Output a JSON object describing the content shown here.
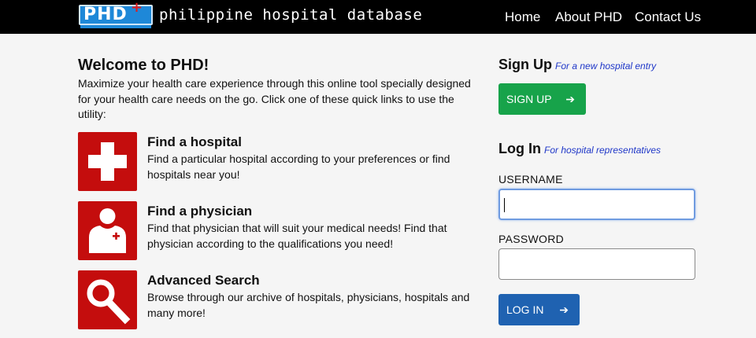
{
  "header": {
    "logo_text": "PHD",
    "tagline": "philippine hospital database",
    "nav": [
      "Home",
      "About PHD",
      "Contact Us"
    ],
    "colors": {
      "bar": "#000000",
      "logo_blue": "#1e88d8",
      "logo_plus": "#e41b1b"
    }
  },
  "welcome": {
    "title": "Welcome to PHD!",
    "text": "Maximize your health care experience through this online tool specially designed for your health care needs on the go. Click one of these quick links to use the utility:"
  },
  "quick_links": [
    {
      "icon": "hospital-cross-icon",
      "title": "Find a hospital",
      "desc": "Find a particular hospital according to your preferences or find hospitals near you!"
    },
    {
      "icon": "physician-icon",
      "title": "Find a physician",
      "desc": "Find that physician that will suit your medical needs! Find that physician according to the qualifications you need!"
    },
    {
      "icon": "magnifier-icon",
      "title": "Advanced Search",
      "desc": "Browse through our archive of hospitals, physicians, hospitals and many more!"
    }
  ],
  "signup": {
    "title": "Sign Up",
    "subtitle": "For a new hospital entry",
    "button": "SIGN UP",
    "button_color": "#17a34a"
  },
  "login": {
    "title": "Log In",
    "subtitle": "For hospital representatives",
    "username_label": "USERNAME",
    "username_value": "",
    "password_label": "PASSWORD",
    "password_value": "",
    "button": "LOG IN",
    "button_color": "#1f62b1"
  },
  "accent_red": "#c40d0d"
}
